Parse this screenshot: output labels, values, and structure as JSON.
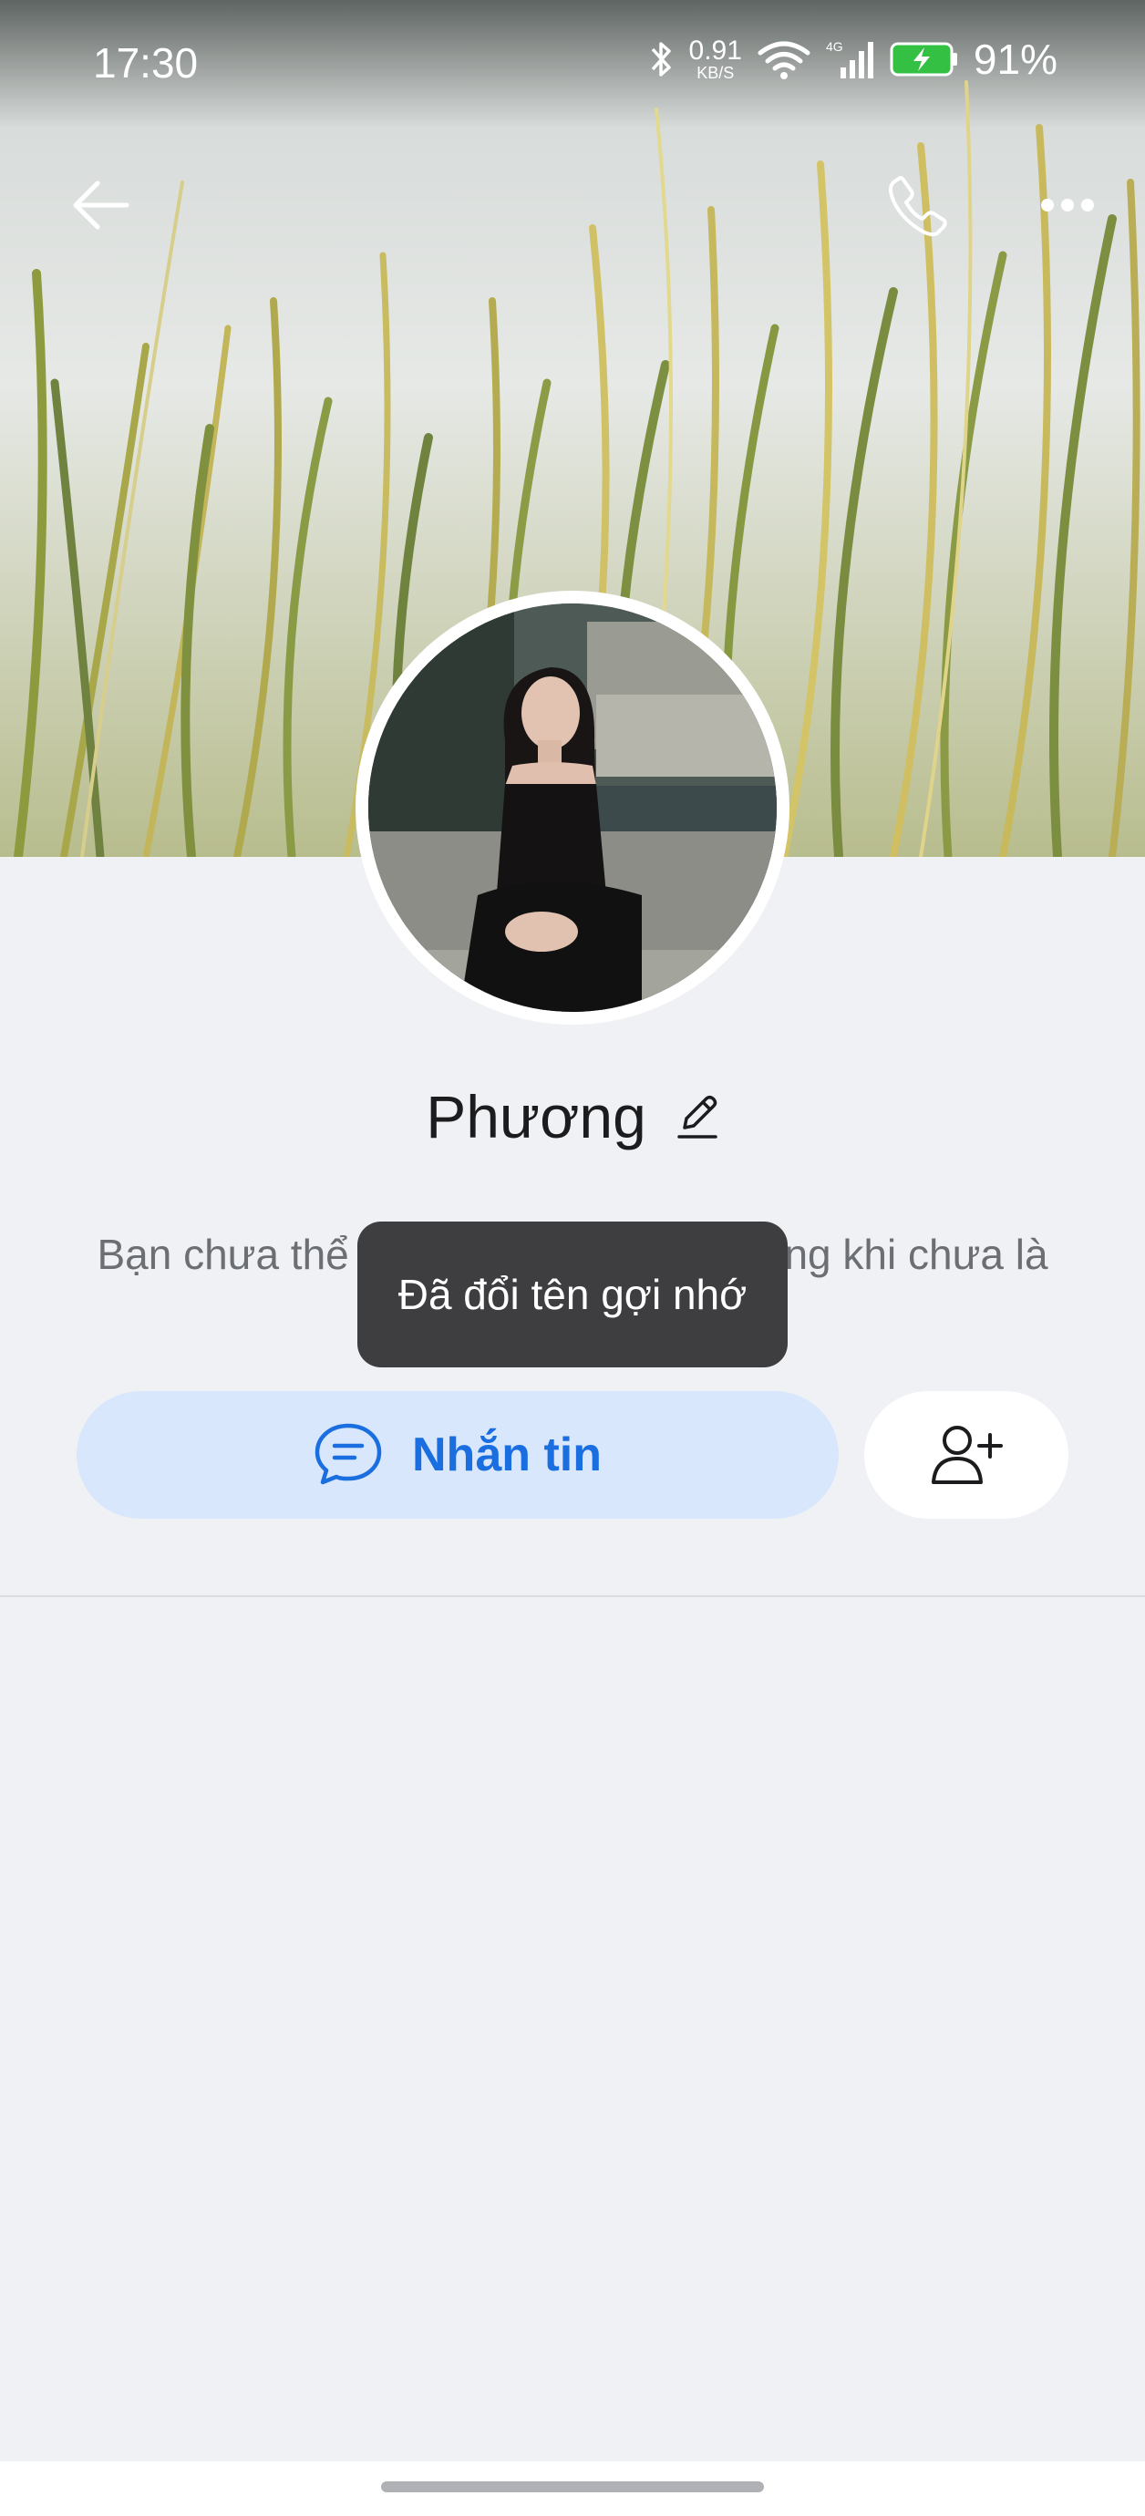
{
  "status_bar": {
    "time": "17:30",
    "net_speed_value": "0.91",
    "net_speed_unit": "KB/S",
    "signal_label": "4G",
    "battery": "91%",
    "icons": [
      "bluetooth-icon",
      "wifi-icon",
      "cellular-signal-icon",
      "battery-charging-icon"
    ]
  },
  "header": {
    "back_icon": "arrow-left-icon",
    "call_icon": "phone-icon",
    "more_icon": "more-dots-icon"
  },
  "profile": {
    "name": "Phương",
    "edit_icon": "pencil-icon",
    "description": "Bạn chưa thể xem nhật ký của Phương khi chưa là bạn bè"
  },
  "toast": {
    "text": "Đã đổi tên gợi nhớ"
  },
  "actions": {
    "message_label": "Nhắn tin",
    "message_icon": "chat-bubble-icon",
    "add_friend_icon": "add-friend-icon"
  },
  "colors": {
    "accent": "#1a6ee0",
    "message_button_bg": "#d8e7fb",
    "page_bg": "#f0f1f4",
    "toast_bg": "#3e3e40"
  }
}
